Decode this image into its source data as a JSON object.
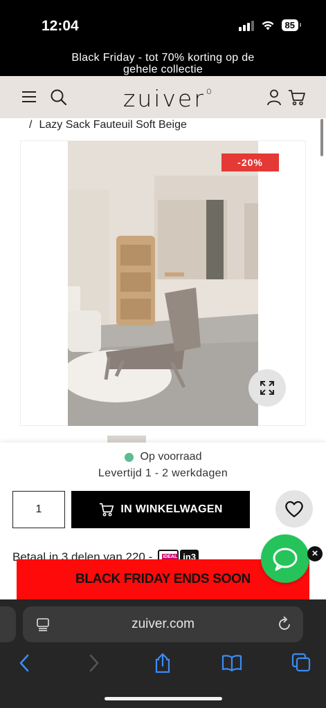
{
  "status_bar": {
    "time": "12:04",
    "battery": "85"
  },
  "promo": {
    "text_line1": "Black Friday - tot 70% korting op de",
    "text_line2": "gehele collectie"
  },
  "header": {
    "logo": "zuiver",
    "logo_mark": "o"
  },
  "breadcrumb": {
    "separator": "/",
    "current": "Lazy Sack Fauteuil Soft Beige"
  },
  "product": {
    "discount": "-20%"
  },
  "buy_panel": {
    "stock": "Op voorraad",
    "delivery": "Levertijd 1 - 2 werkdagen",
    "quantity": "1",
    "add_to_cart": "IN WINKELWAGEN",
    "installment_text": "Betaal in 3 delen van 220,-",
    "ideal": "iDEAL",
    "in3": "in3"
  },
  "banner": {
    "text": "BLACK FRIDAY ENDS SOON"
  },
  "browser": {
    "url": "zuiver.com"
  },
  "colors": {
    "accent_green": "#25c35a",
    "discount_red": "#e53935",
    "banner_red": "#ff0a0a",
    "header_beige": "#e8e3de",
    "stock_green": "#5dbb8f"
  }
}
